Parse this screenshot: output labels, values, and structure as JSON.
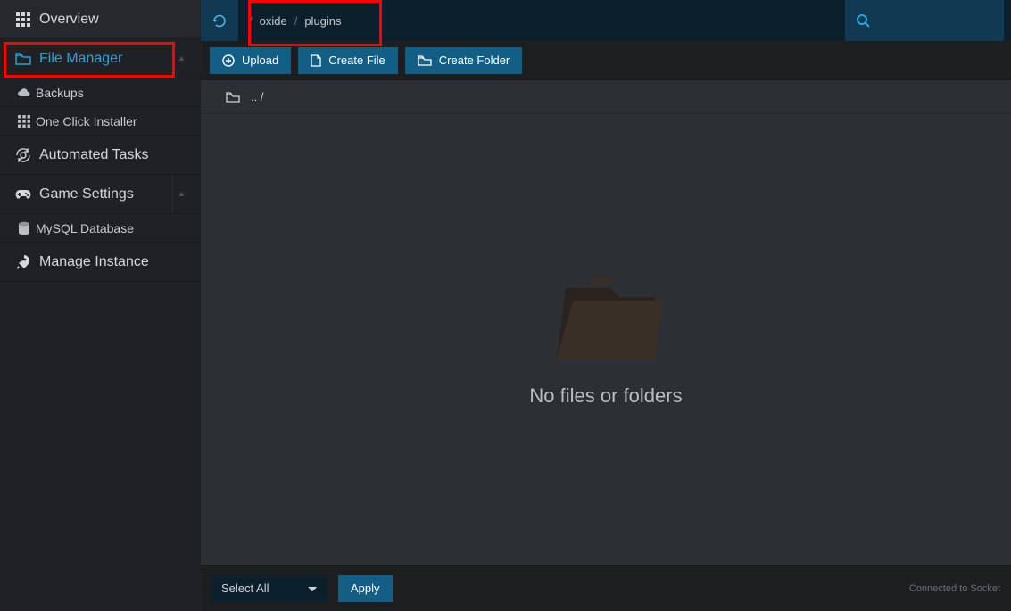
{
  "sidebar": {
    "items": [
      {
        "label": "Overview",
        "icon": "grid-icon"
      },
      {
        "label": "File Manager",
        "icon": "folder-icon",
        "active": true,
        "expandable": true
      },
      {
        "label": "Automated Tasks",
        "icon": "gear-cycle-icon"
      },
      {
        "label": "Game Settings",
        "icon": "gamepad-icon",
        "expandable": true
      },
      {
        "label": "Manage Instance",
        "icon": "rocket-icon"
      }
    ],
    "fileManagerSub": [
      {
        "label": "Backups",
        "icon": "cloud-icon"
      },
      {
        "label": "One Click Installer",
        "icon": "grid-icon"
      }
    ],
    "gameSettingsSub": [
      {
        "label": "MySQL Database",
        "icon": "database-icon"
      }
    ]
  },
  "breadcrumb": {
    "segments": [
      "oxide",
      "plugins"
    ]
  },
  "toolbar": {
    "upload": "Upload",
    "createFile": "Create File",
    "createFolder": "Create Folder"
  },
  "pathRow": {
    "up": ".. /"
  },
  "empty": {
    "message": "No files or folders"
  },
  "footer": {
    "selectAll": "Select All",
    "apply": "Apply",
    "socket": "Connected to Socket"
  }
}
